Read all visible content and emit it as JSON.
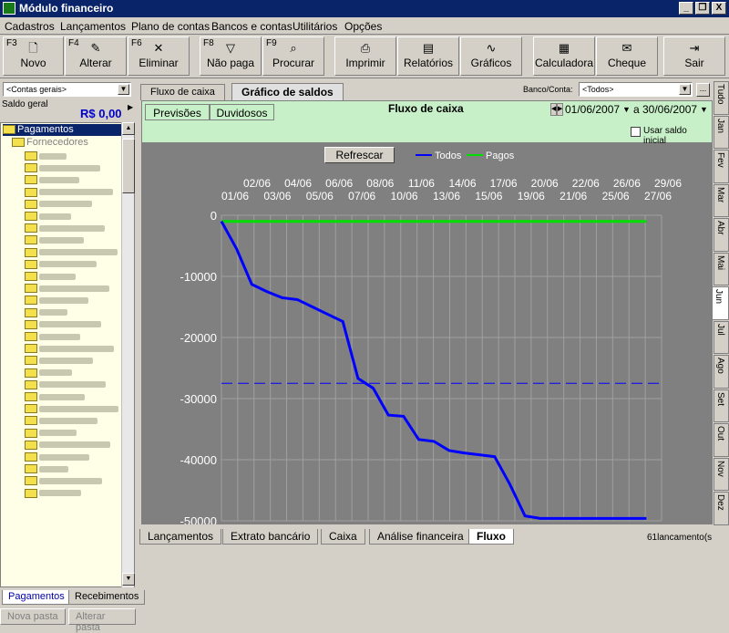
{
  "window": {
    "title": "Módulo financeiro",
    "controls": [
      "_",
      "❐",
      "X"
    ]
  },
  "menu": [
    "Cadastros",
    "Lançamentos",
    "Plano de contas",
    "Bancos e contas",
    "Utilitários",
    "Opções"
  ],
  "toolbar": {
    "buttons": [
      {
        "key": "F3",
        "label": "Novo",
        "icon": "new-doc-icon",
        "glyph": "🗋"
      },
      {
        "key": "F4",
        "label": "Alterar",
        "icon": "edit-icon",
        "glyph": "✎"
      },
      {
        "key": "F6",
        "label": "Eliminar",
        "icon": "delete-icon",
        "glyph": "✕"
      },
      {
        "key": "F8",
        "label": "Não paga",
        "icon": "filter-icon",
        "glyph": "▽"
      },
      {
        "key": "F9",
        "label": "Procurar",
        "icon": "binoculars-icon",
        "glyph": "⌕"
      },
      {
        "key": "",
        "label": "Imprimir",
        "icon": "printer-icon",
        "glyph": "⎙"
      },
      {
        "key": "",
        "label": "Relatórios",
        "icon": "report-icon",
        "glyph": "▤"
      },
      {
        "key": "",
        "label": "Gráficos",
        "icon": "chart-icon",
        "glyph": "∿"
      },
      {
        "key": "",
        "label": "Calculadora",
        "icon": "calculator-icon",
        "glyph": "▦"
      },
      {
        "key": "",
        "label": "Cheque",
        "icon": "cheque-icon",
        "glyph": "✉"
      },
      {
        "key": "",
        "label": "Sair",
        "icon": "exit-icon",
        "glyph": "⇥"
      }
    ]
  },
  "left": {
    "account_select": "<Contas gerais>",
    "saldo_label": "Saldo geral",
    "saldo_value": "R$  0,00",
    "tree": {
      "root": "Pagamentos",
      "child": "Fornecedores"
    },
    "bottom_tabs": [
      "Pagamentos",
      "Recebimentos"
    ],
    "bottom_buttons": [
      "Nova pasta",
      "Alterar pasta"
    ]
  },
  "main": {
    "tabs": [
      "Fluxo de caixa",
      "Gráfico de saldos"
    ],
    "subtabs": [
      "Previsões",
      "Duvidosos"
    ],
    "panel_title": "Fluxo de caixa",
    "banco_label": "Banco/Conta:",
    "banco_value": "<Todos>",
    "date_from": "01/06/2007",
    "date_to_label": "a",
    "date_to": "30/06/2007",
    "usar_saldo_label": "Usar saldo inicial",
    "refresh_label": "Refrescar"
  },
  "month_tabs": [
    "Tudo",
    "Jan",
    "Fev",
    "Mar",
    "Abr",
    "Mai",
    "Jun",
    "Jul",
    "Ago",
    "Set",
    "Out",
    "Nov",
    "Dez"
  ],
  "status": {
    "tabs": [
      "Lançamentos",
      "Extrato bancário",
      "Caixa",
      "Análise financeira",
      "Fluxo"
    ],
    "count": "61lancamento(s"
  },
  "chart_data": {
    "type": "line",
    "legend_position": "top",
    "x_ticks_top": [
      "02/06",
      "04/06",
      "06/06",
      "08/06",
      "11/06",
      "14/06",
      "17/06",
      "20/06",
      "22/06",
      "26/06",
      "29/06"
    ],
    "x_ticks_bottom": [
      "01/06",
      "03/06",
      "05/06",
      "07/06",
      "10/06",
      "13/06",
      "15/06",
      "19/06",
      "21/06",
      "25/06",
      "27/06"
    ],
    "y_ticks": [
      "0",
      "-10000",
      "-20000",
      "-30000",
      "-40000",
      "-50000"
    ],
    "ylim": [
      -50000,
      0
    ],
    "x_count": 30,
    "grid": true,
    "colors": {
      "todos": "#0000ff",
      "pagos": "#00dd00"
    },
    "series": [
      {
        "name": "Todos",
        "x": [
          0,
          1,
          2,
          3,
          4,
          5,
          6,
          7,
          8,
          9,
          10,
          11,
          12,
          13,
          14,
          15,
          16,
          17,
          18,
          19,
          20,
          21,
          22,
          23,
          24,
          25,
          26,
          27,
          28
        ],
        "values": [
          -1000,
          -5500,
          -11300,
          -12500,
          -13500,
          -13800,
          -15000,
          -16200,
          -17400,
          -26700,
          -28300,
          -32700,
          -32900,
          -36700,
          -37000,
          -38500,
          -38900,
          -39200,
          -39500,
          -44000,
          -49200,
          -49600,
          -49600,
          -49600,
          -49600,
          -49600,
          -49600,
          -49600,
          -49600
        ]
      },
      {
        "name": "Pagos",
        "x": [
          0,
          28
        ],
        "values": [
          -1000,
          -1000
        ]
      }
    ],
    "reference_line": -27500
  }
}
